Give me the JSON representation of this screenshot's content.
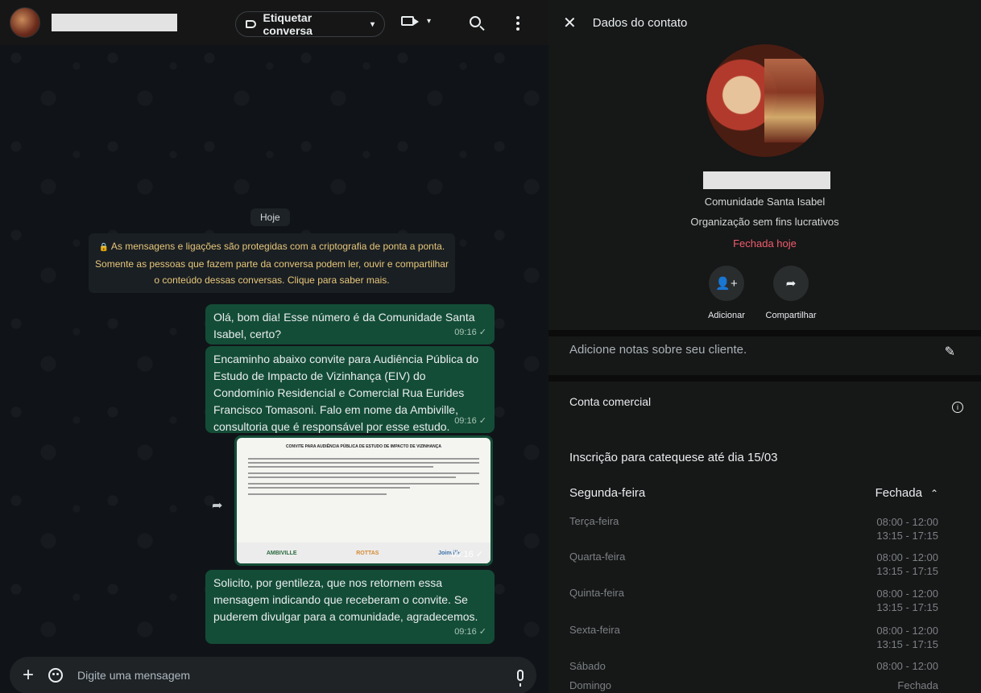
{
  "chat": {
    "header": {
      "tag_button": "Etiquetar conversa"
    },
    "day_label": "Hoje",
    "encryption_notice": [
      "As mensagens e ligações são protegidas com a criptografia de ponta a ponta.",
      "Somente as pessoas que fazem parte da conversa podem ler, ouvir e compartilhar",
      "o conteúdo dessas conversas. Clique para saber mais."
    ],
    "messages": [
      {
        "text": "Olá, bom dia! Esse número é da Comunidade Santa Isabel, certo?",
        "time": "09:16 ✓"
      },
      {
        "text": "Encaminho abaixo convite para Audiência Pública do Estudo de Impacto de Vizinhança (EIV) do Condomínio Residencial e Comercial Rua Eurides Francisco Tomasoni. Falo em nome da Ambiville, consultoria que é responsável por esse estudo.",
        "time": "09:16 ✓"
      },
      {
        "image_time": "09:16 ✓",
        "doc_title": "CONVITE PARA AUDIÊNCIA PÚBLICA DE ESTUDO DE IMPACTO DE VIZINHANÇA",
        "doc_logos": [
          "AMBIVILLE",
          "ROTTAS",
          "Joinville"
        ]
      },
      {
        "text": "Solicito, por gentileza, que nos retornem essa mensagem indicando que receberam o convite. Se puderem divulgar para a comunidade, agradecemos.",
        "time": "09:16 ✓"
      }
    ],
    "composer": {
      "placeholder": "Digite uma mensagem"
    }
  },
  "contact": {
    "title": "Dados do contato",
    "community": "Comunidade Santa Isabel",
    "category": "Organização sem fins lucrativos",
    "status": "Fechada hoje",
    "actions": [
      {
        "label": "Adicionar",
        "icon": "add-person-icon"
      },
      {
        "label": "Compartilhar",
        "icon": "share-icon"
      }
    ],
    "notes_placeholder": "Adicione notas sobre seu cliente.",
    "business_account": "Conta comercial",
    "description": "Inscrição para catequese até dia 15/03",
    "hours": [
      {
        "day": "Segunda-feira",
        "value": "Fechada"
      },
      {
        "day": "Terça-feira",
        "value": "08:00 - 12:00",
        "value2": "13:15 - 17:15"
      },
      {
        "day": "Quarta-feira",
        "value": "08:00 - 12:00",
        "value2": "13:15 - 17:15"
      },
      {
        "day": "Quinta-feira",
        "value": "08:00 - 12:00",
        "value2": "13:15 - 17:15"
      },
      {
        "day": "Sexta-feira",
        "value": "08:00 - 12:00",
        "value2": "13:15 - 17:15"
      },
      {
        "day": "Sábado",
        "value": "08:00 - 12:00"
      },
      {
        "day": "Domingo",
        "value": "Fechada"
      }
    ]
  },
  "colors": {
    "bubble": "#144d37",
    "closed": "#f15c6d",
    "notice": "#e8c77b"
  }
}
